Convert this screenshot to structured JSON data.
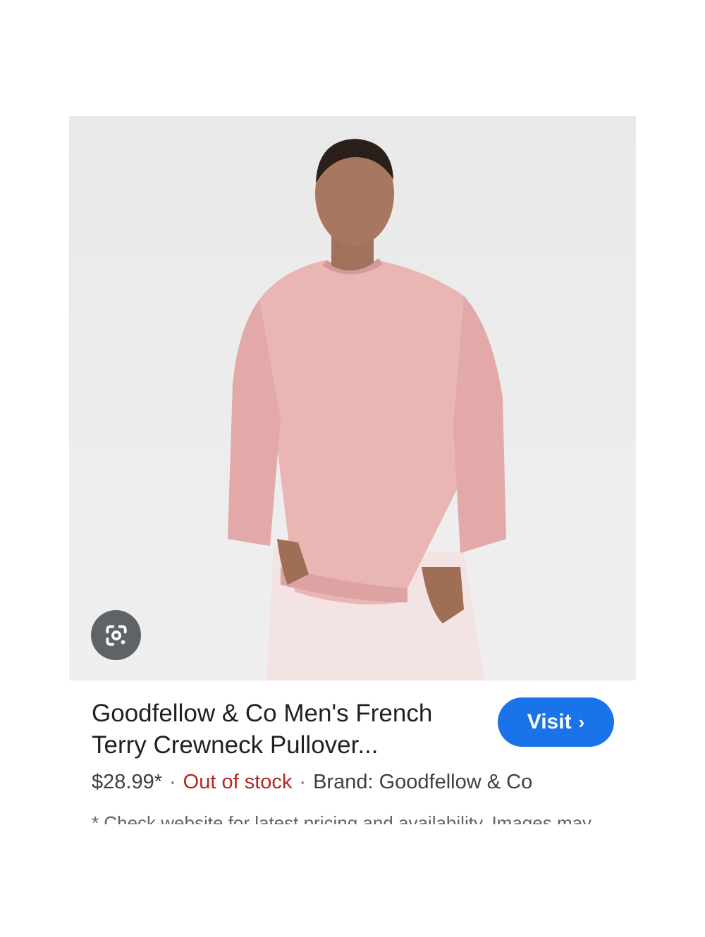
{
  "product": {
    "title": "Goodfellow & Co Men's French Terry Crewneck Pullover...",
    "price": "$28.99*",
    "separator": "·",
    "availability": "Out of stock",
    "brand": "Brand: Goodfellow & Co",
    "disclaimer": "* Check website for latest pricing and availability. Images may"
  },
  "actions": {
    "visit_label": "Visit",
    "visit_chevron": "›"
  },
  "icons": {
    "lens": "google-lens-icon",
    "chevron": "chevron-right-icon"
  },
  "colors": {
    "visit_button": "#1a73e8",
    "out_of_stock": "#b3261e",
    "sweater": "#e9b3b3",
    "background": "#ececec"
  }
}
